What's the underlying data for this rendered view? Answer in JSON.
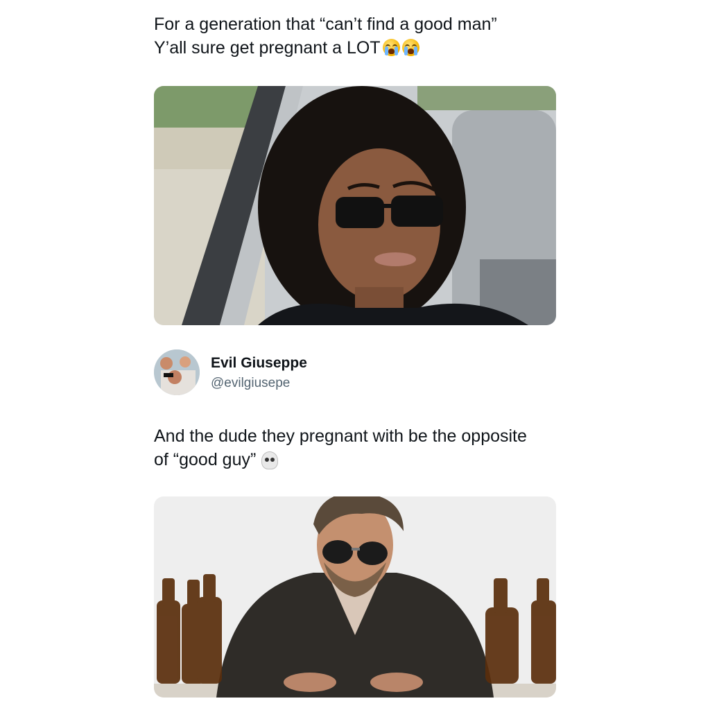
{
  "original_post": {
    "text_line1": "For a generation that “can’t find a good man”",
    "text_line2": "Y’all sure get pregnant a LOT",
    "emojis": [
      "loudly-crying-face",
      "loudly-crying-face"
    ]
  },
  "reply": {
    "display_name": "Evil Giuseppe",
    "handle": "@evilgiusepe",
    "text_line1": "And the dude they pregnant with be the opposite",
    "text_line2": "of “good guy”",
    "emojis": [
      "skull"
    ]
  },
  "colors": {
    "background": "#ffffff",
    "text": "#0f1419",
    "handle": "#536471"
  }
}
